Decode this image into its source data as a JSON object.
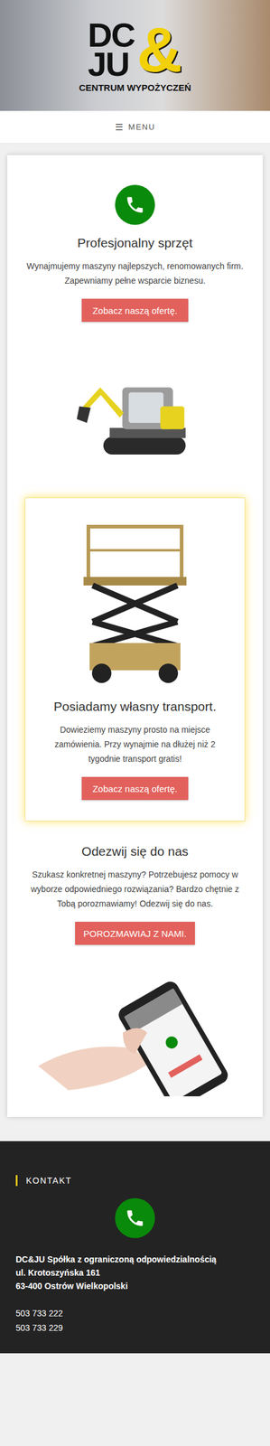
{
  "header": {
    "logo": {
      "top": "DC",
      "bottom": "JU",
      "ampersand": "&",
      "tagline": "CENTRUM WYPOŻYCZEŃ"
    }
  },
  "menu": {
    "icon": "☰",
    "label": "MENU"
  },
  "intro": {
    "title": "Profesjonalny sprzęt",
    "text": "Wynajmujemy maszyny najlepszych, renomowanych firm. Zapewniamy pełne wsparcie biznesu.",
    "button": "Zobacz naszą ofertę."
  },
  "transport": {
    "title": "Posiadamy własny transport.",
    "text": "Dowieziemy maszyny prosto na miejsce zamówienia. Przy wynajmie na dłużej niż 2 tygodnie transport gratis!",
    "button": "Zobacz naszą ofertę."
  },
  "contact": {
    "title": "Odezwij się do nas",
    "text": "Szukasz konkretnej maszyny? Potrzebujesz pomocy w wyborze odpowiedniego rozwiązania? Bardzo chętnie z Tobą porozmawiamy! Odezwij się do nas.",
    "button": "POROZMAWIAJ Z NAMI."
  },
  "footer": {
    "heading": "KONTAKT",
    "company": "DC&JU Spółka z ograniczoną odpowiedzialnością",
    "street": "ul. Krotoszyńska 161",
    "city": "63-400 Ostrów Wielkopolski",
    "phones": [
      "503 733 222",
      "503 733 229"
    ]
  }
}
